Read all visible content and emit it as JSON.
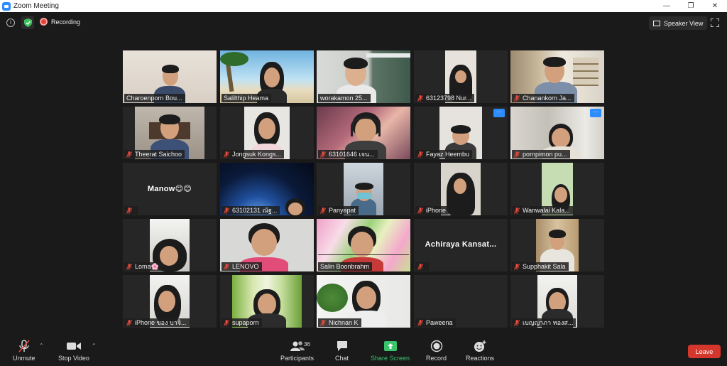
{
  "window": {
    "title": "Zoom Meeting",
    "minimize": "—",
    "restore": "❐",
    "close": "✕"
  },
  "topbar": {
    "recording_label": "Recording",
    "speaker_view_label": "Speaker View"
  },
  "participants": [
    "Charoenporn Bou...",
    "Salilthip Heama",
    "worakamon 25...",
    "63123798 Nur...",
    "Chanankorn Ja...",
    "Theerat Saichoo",
    "Jongsuk Kongs...",
    "63101646 เจน...",
    "Fayaz Heembu",
    "pornpimon pu...",
    "Manow😊😊",
    "63102131 ณัฐ...",
    "Panyapat",
    "iPhone",
    "Wanwalai Kala...",
    "Loma🌸",
    "LENOVO",
    "Salin Boonbrahm",
    "Achiraya Kansat...",
    "Supphakit Sala",
    "iPhone ของ บาจิ...",
    "supaporn",
    "Nichnan K",
    "Paweena",
    "เบญญาภา ทองส..."
  ],
  "more_badge": "···",
  "toolbar": {
    "unmute": "Unmute",
    "stop_video": "Stop Video",
    "participants": "Participants",
    "participants_count": "36",
    "chat": "Chat",
    "share_screen": "Share Screen",
    "record": "Record",
    "reactions": "Reactions",
    "leave": "Leave"
  },
  "colors": {
    "accent_green": "#39c36b",
    "leave_red": "#d6372d",
    "active_speaker": "#a6d66a",
    "zoom_blue": "#2d8cff"
  }
}
